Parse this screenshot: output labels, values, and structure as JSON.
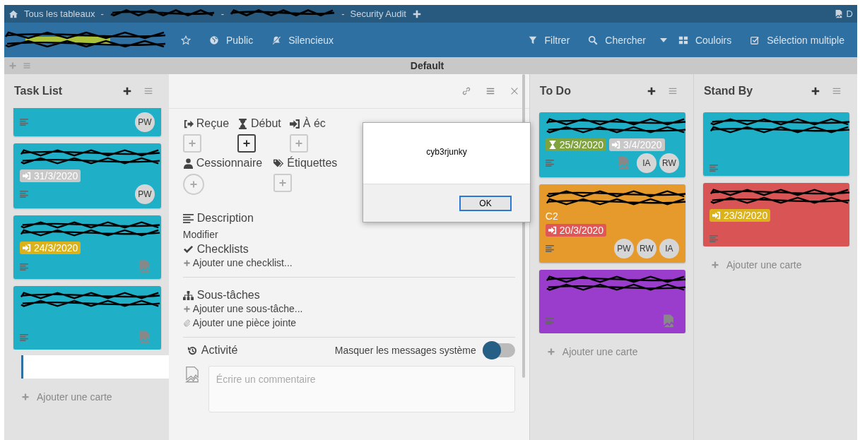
{
  "topbar": {
    "home": "Tous les tableaux",
    "crumbs": [
      {
        "sep": "-",
        "kind": "scribbled"
      },
      {
        "sep": "-",
        "kind": "scribbled"
      },
      {
        "sep": "-",
        "kind": "text",
        "text": "Security Audit"
      }
    ],
    "user_initial": "D"
  },
  "header": {
    "left": [
      "Public",
      "Silencieux"
    ],
    "right": [
      "Filtrer",
      "Chercher",
      "Couloirs",
      "Sélection multiple"
    ]
  },
  "swimlane": {
    "title": "Default"
  },
  "lists": [
    {
      "title": "Task List",
      "scrolled": true,
      "composer_open": true,
      "add_card": "Ajouter une carte",
      "cards": [
        {
          "color": "#1fb0c8",
          "kind": "plain",
          "members": [
            {
              "kind": "initials",
              "initials": "PW"
            }
          ]
        },
        {
          "color": "#1fb0c8",
          "kind": "scribbled",
          "badges": [
            {
              "kind": "due",
              "date": "31/3/2020",
              "color": "#c8c8c8"
            }
          ],
          "members": [
            {
              "kind": "initials",
              "initials": "PW"
            }
          ]
        },
        {
          "color": "#1fb0c8",
          "kind": "scribbled",
          "badges": [
            {
              "kind": "due",
              "date": "24/3/2020",
              "color": "#dbb21b"
            }
          ],
          "members": [
            {
              "kind": "image"
            }
          ]
        },
        {
          "color": "#1fb0c8",
          "kind": "scribbled",
          "members": [
            {
              "kind": "image"
            }
          ]
        }
      ]
    },
    {
      "title": "To Do",
      "scrolled": false,
      "composer_open": false,
      "add_card": "Ajouter une carte",
      "cards": [
        {
          "color": "#1fb0c8",
          "kind": "scribbled",
          "badges": [
            {
              "kind": "start",
              "date": "25/3/2020",
              "color": "#7fa33f"
            },
            {
              "kind": "due",
              "date": "3/4/2020",
              "color": "#c8c8c8"
            }
          ],
          "members": [
            {
              "kind": "image"
            },
            {
              "kind": "initials",
              "initials": "IA"
            },
            {
              "kind": "initials",
              "initials": "RW"
            }
          ]
        },
        {
          "color": "#e59a2b",
          "kind": "scribbled",
          "title_tail": "C2",
          "badges": [
            {
              "kind": "due",
              "date": "20/3/2020",
              "color": "#e05757"
            }
          ],
          "members": [
            {
              "kind": "initials",
              "initials": "PW"
            },
            {
              "kind": "initials",
              "initials": "RW"
            },
            {
              "kind": "initials",
              "initials": "IA"
            }
          ]
        },
        {
          "color": "#9a3ccc",
          "kind": "scribbled",
          "members": [
            {
              "kind": "image"
            }
          ]
        }
      ]
    },
    {
      "title": "Stand By",
      "scrolled": false,
      "composer_open": false,
      "add_card": "Ajouter une carte",
      "cards": [
        {
          "color": "#1fb0c8",
          "kind": "scribbled"
        },
        {
          "color": "#d95555",
          "kind": "scribbled",
          "badges": [
            {
              "kind": "due",
              "date": "23/3/2020",
              "color": "#dbb21b"
            }
          ]
        }
      ]
    }
  ],
  "card_details": {
    "dates": [
      {
        "label": "Reçue",
        "focused": false
      },
      {
        "label": "Début",
        "focused": true
      },
      {
        "label": "À éc",
        "focused": false
      }
    ],
    "assignee_label": "Cessionnaire",
    "labels_label": "Étiquettes",
    "description_title": "Description",
    "description_edit": "Modifier",
    "checklists_title": "Checklists",
    "add_checklist": "Ajouter une checklist...",
    "subtasks_title": "Sous-tâches",
    "add_subtask": "Ajouter une sous-tâche...",
    "add_attachment": "Ajouter une pièce jointe",
    "activity_title": "Activité",
    "hide_system": {
      "label": "Masquer les messages système",
      "on": false
    },
    "comment": {
      "placeholder": "Écrire un commentaire"
    }
  },
  "dialog": {
    "message": "cyb3rjunky",
    "ok": "OK"
  }
}
